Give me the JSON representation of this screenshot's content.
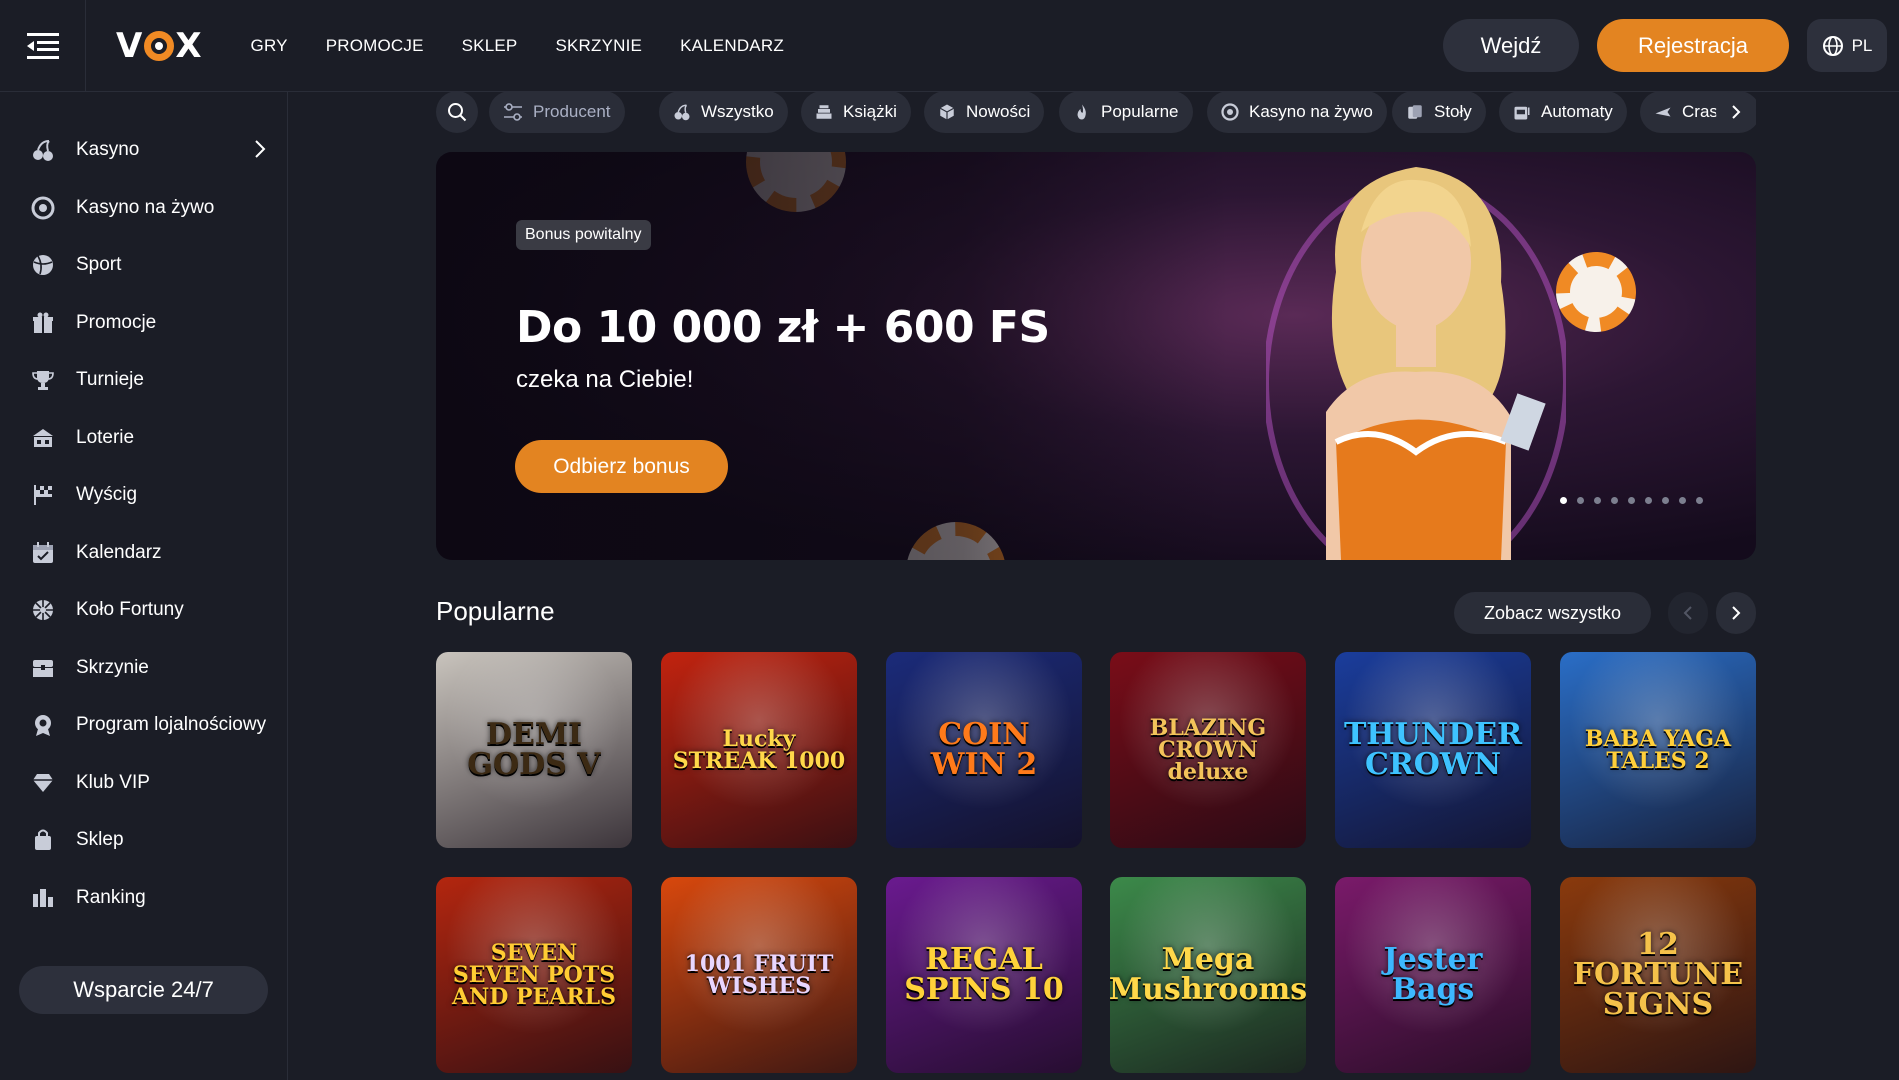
{
  "header": {
    "logo_text": "VOX",
    "nav": [
      "GRY",
      "PROMOCJE",
      "SKLEP",
      "SKRZYNIE",
      "KALENDARZ"
    ],
    "login_label": "Wejdź",
    "register_label": "Rejestracja",
    "lang": "PL"
  },
  "sidebar": {
    "items": [
      {
        "label": "Kasyno",
        "icon": "cherries-icon"
      },
      {
        "label": "Kasyno na żywo",
        "icon": "live-chip-icon"
      },
      {
        "label": "Sport",
        "icon": "ball-icon"
      },
      {
        "label": "Promocje",
        "icon": "gift-icon"
      },
      {
        "label": "Turnieje",
        "icon": "trophy-icon"
      },
      {
        "label": "Loterie",
        "icon": "lottery-icon"
      },
      {
        "label": "Wyścig",
        "icon": "race-flag-icon"
      },
      {
        "label": "Kalendarz",
        "icon": "calendar-icon"
      },
      {
        "label": "Koło Fortuny",
        "icon": "wheel-icon"
      },
      {
        "label": "Skrzynie",
        "icon": "chest-icon"
      },
      {
        "label": "Program lojalnościowy",
        "icon": "medal-icon"
      },
      {
        "label": "Klub VIP",
        "icon": "diamond-icon"
      },
      {
        "label": "Sklep",
        "icon": "bag-icon"
      },
      {
        "label": "Ranking",
        "icon": "bars-icon"
      }
    ],
    "support_label": "Wsparcie 24/7"
  },
  "filters": {
    "producer_label": "Producent",
    "chips": [
      "Wszystko",
      "Książki",
      "Nowości",
      "Popularne",
      "Kasyno na żywo",
      "Stoły",
      "Automaty",
      "Cras"
    ]
  },
  "banner": {
    "badge": "Bonus powitalny",
    "title": "Do 10 000 zł + 600 FS",
    "subtitle": "czeka na Ciebie!",
    "cta": "Odbierz bonus",
    "slides_total": 9,
    "slide_active": 1
  },
  "popular": {
    "title": "Popularne",
    "see_all": "Zobacz wszystko",
    "games": [
      {
        "name": "DEMI GODS V",
        "bg": "#c9c4bd",
        "color": "#3c2a14"
      },
      {
        "name": "Lucky STREAK 1000",
        "bg": "#c2230f",
        "color": "#ffd84a"
      },
      {
        "name": "COIN WIN 2",
        "bg": "#1b2b7a",
        "color": "#ff7a1a"
      },
      {
        "name": "BLAZING CROWN deluxe",
        "bg": "#7a0d18",
        "color": "#f3c35a"
      },
      {
        "name": "THUNDER CROWN",
        "bg": "#1a3d9c",
        "color": "#3ec3ff"
      },
      {
        "name": "BABA YAGA TALES 2",
        "bg": "#2a6ec7",
        "color": "#ffcf3a"
      },
      {
        "name": "SEVEN SEVEN POTS AND PEARLS",
        "bg": "#b3260f",
        "color": "#ffcc33"
      },
      {
        "name": "1001 FRUIT WISHES",
        "bg": "#d8480d",
        "color": "#e9d6ff"
      },
      {
        "name": "REGAL SPINS 10",
        "bg": "#6a1a8f",
        "color": "#ffd23a"
      },
      {
        "name": "Mega Mushrooms",
        "bg": "#3c8a4a",
        "color": "#ffd84a"
      },
      {
        "name": "Jester Bags",
        "bg": "#7a1a6a",
        "color": "#3db8ff"
      },
      {
        "name": "12 FORTUNE SIGNS",
        "bg": "#8a3a0d",
        "color": "#f5c24a"
      }
    ]
  },
  "colors": {
    "accent": "#e38421",
    "surface": "#2a2d38",
    "bg": "#1b1d26"
  }
}
